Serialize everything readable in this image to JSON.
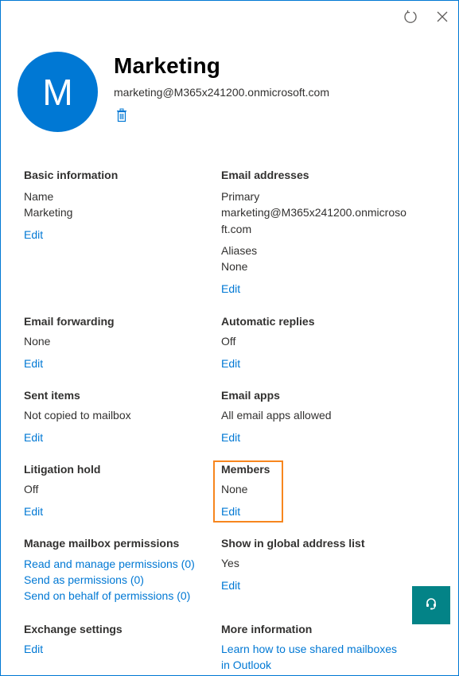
{
  "header": {
    "avatar_letter": "M",
    "title": "Marketing",
    "email": "marketing@M365x241200.onmicrosoft.com",
    "icons": [
      "refresh-icon",
      "close-icon",
      "delete-icon"
    ]
  },
  "colors": {
    "accent": "#0078d4",
    "highlight": "#f7861e",
    "chat_button": "#038387"
  },
  "sections": {
    "basic": {
      "heading": "Basic information",
      "label": "Name",
      "value": "Marketing",
      "edit": "Edit"
    },
    "email_addresses": {
      "heading": "Email addresses",
      "primary_label": "Primary",
      "primary_value_line1": "marketing@M365x241200.onmicroso",
      "primary_value_line2": "ft.com",
      "aliases_label": "Aliases",
      "aliases_value": "None",
      "edit": "Edit"
    },
    "forwarding": {
      "heading": "Email forwarding",
      "value": "None",
      "edit": "Edit"
    },
    "auto_replies": {
      "heading": "Automatic replies",
      "value": "Off",
      "edit": "Edit"
    },
    "sent_items": {
      "heading": "Sent items",
      "value": "Not copied to mailbox",
      "edit": "Edit"
    },
    "email_apps": {
      "heading": "Email apps",
      "value": "All email apps allowed",
      "edit": "Edit"
    },
    "litigation": {
      "heading": "Litigation hold",
      "value": "Off",
      "edit": "Edit"
    },
    "members": {
      "heading": "Members",
      "value": "None",
      "edit": "Edit"
    },
    "permissions": {
      "heading": "Manage mailbox permissions",
      "links": [
        "Read and manage permissions (0)",
        "Send as permissions (0)",
        "Send on behalf of permissions (0)"
      ]
    },
    "gal": {
      "heading": "Show in global address list",
      "value": "Yes",
      "edit": "Edit"
    },
    "exchange": {
      "heading": "Exchange settings",
      "edit": "Edit"
    },
    "more_info": {
      "heading": "More information",
      "link_line1": "Learn how to use shared mailboxes",
      "link_line2": "in Outlook"
    }
  }
}
